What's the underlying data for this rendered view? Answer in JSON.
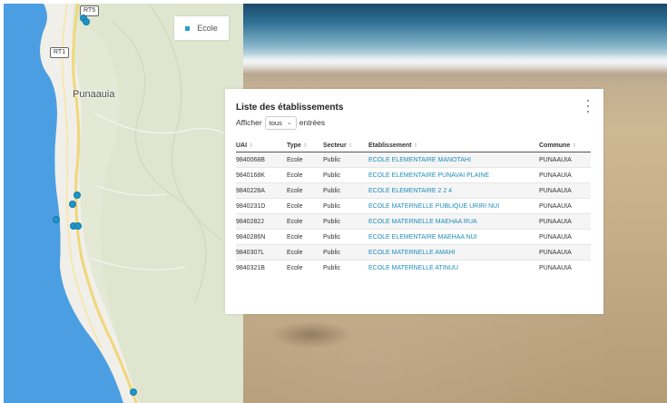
{
  "map": {
    "place_label": "Punaauia",
    "route_labels": [
      "RT5",
      "RT1"
    ],
    "legend_label": "Ecole",
    "colors": {
      "sea": "#4c9ee3",
      "land": "#e6ead9",
      "marker": "#1e96c8",
      "road": "#f0d77a"
    }
  },
  "panel": {
    "title": "Liste des établissements",
    "show_prefix": "Afficher",
    "show_value": "tous",
    "show_suffix": "entrées",
    "columns": [
      "UAI",
      "Type",
      "Secteur",
      "Etablissement",
      "Commune"
    ],
    "rows": [
      [
        "9840068B",
        "Ecole",
        "Public",
        "ECOLE ELEMENTAIRE MANOTAHI",
        "PUNAAUIA"
      ],
      [
        "9840168K",
        "Ecole",
        "Public",
        "ECOLE ELEMENTAIRE PUNAVAI PLAINE",
        "PUNAAUIA"
      ],
      [
        "9840228A",
        "Ecole",
        "Public",
        "ECOLE ELEMENTAIRE 2 2 4",
        "PUNAAUIA"
      ],
      [
        "9840231D",
        "Ecole",
        "Public",
        "ECOLE MATERNELLE PUBLIQUE URIRI NUI",
        "PUNAAUIA"
      ],
      [
        "9840282J",
        "Ecole",
        "Public",
        "ECOLE MATERNELLE MAEHAA RUA",
        "PUNAAUIA"
      ],
      [
        "9840286N",
        "Ecole",
        "Public",
        "ECOLE ELEMENTAIRE MAEHAA NUI",
        "PUNAAUIA"
      ],
      [
        "9840307L",
        "Ecole",
        "Public",
        "ECOLE MATERNELLE AMAHI",
        "PUNAAUIA"
      ],
      [
        "9840321B",
        "Ecole",
        "Public",
        "ECOLE MATERNELLE ATINUU",
        "PUNAAUIA"
      ]
    ]
  }
}
